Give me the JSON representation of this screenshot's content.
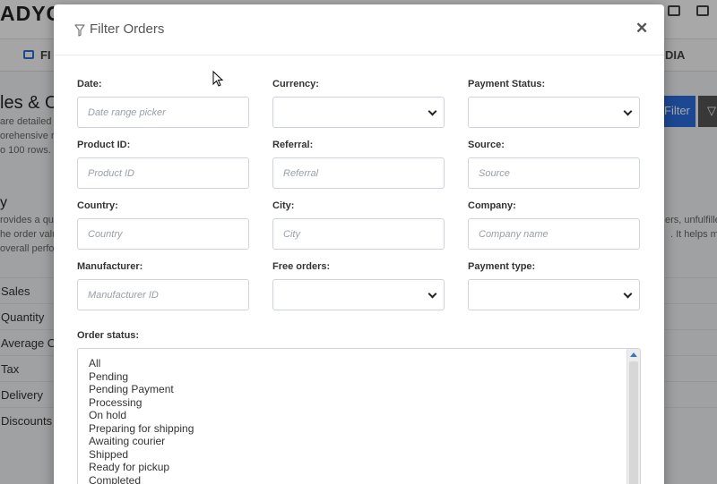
{
  "background": {
    "logo": "ADYC",
    "nav": {
      "item1": "FI",
      "item2": "DIA"
    },
    "page": {
      "title": "les & Or",
      "lines": [
        "are detailed s",
        "orehensive re",
        "o 100 rows."
      ],
      "filter_button": "Filter",
      "section_title": "y",
      "section_lines": [
        "rovides a qu",
        "he order valu",
        "overall perfo"
      ],
      "section_right_lines": [
        "ers, unfulfilled",
        ". It helps m"
      ],
      "rows": [
        "Sales",
        "Quantity",
        "Average O",
        "Tax",
        "Delivery",
        "Discounts"
      ]
    }
  },
  "modal": {
    "title": "Filter Orders",
    "close_icon": "close-icon",
    "title_icon": "filter-icon",
    "fields": {
      "date": {
        "label": "Date:",
        "placeholder": "Date range picker"
      },
      "currency": {
        "label": "Currency:",
        "value": ""
      },
      "payment_status": {
        "label": "Payment Status:",
        "value": ""
      },
      "product_id": {
        "label": "Product ID:",
        "placeholder": "Product ID"
      },
      "referral": {
        "label": "Referral:",
        "placeholder": "Referral"
      },
      "source": {
        "label": "Source:",
        "placeholder": "Source"
      },
      "country": {
        "label": "Country:",
        "placeholder": "Country"
      },
      "city": {
        "label": "City:",
        "placeholder": "City"
      },
      "company": {
        "label": "Company:",
        "placeholder": "Company name"
      },
      "manufacturer": {
        "label": "Manufacturer:",
        "placeholder": "Manufacturer ID"
      },
      "free_orders": {
        "label": "Free orders:",
        "value": ""
      },
      "payment_type": {
        "label": "Payment type:",
        "value": ""
      }
    },
    "order_status": {
      "label": "Order status:",
      "options": [
        "All",
        "Pending",
        "Pending Payment",
        "Processing",
        "On hold",
        "Preparing for shipping",
        "Awaiting courier",
        "Shipped",
        "Ready for pickup",
        "Completed"
      ]
    }
  }
}
